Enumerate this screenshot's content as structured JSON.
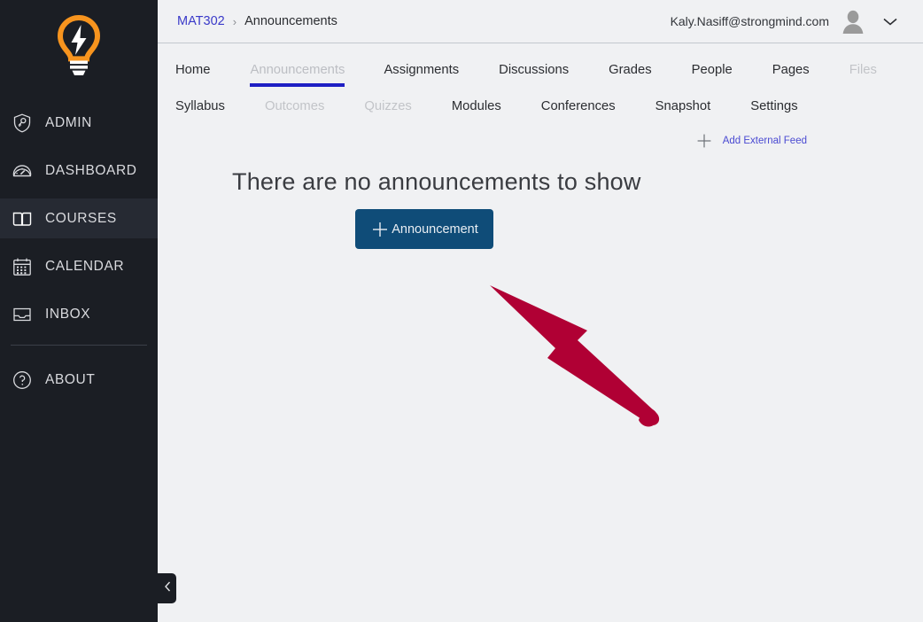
{
  "theme": {
    "sidebar_bg": "#1b1e24",
    "sidebar_active_bg": "#262a33",
    "content_bg": "#f0f1f3",
    "accent_blue": "#1f1fc4",
    "link_blue": "#3a3ac9",
    "button_blue": "#0f4c78",
    "logo_orange": "#F7941E",
    "annotation_red": "#b00034"
  },
  "sidebar": {
    "logo_name": "lightbulb-logo",
    "items": [
      {
        "label": "ADMIN",
        "icon": "shield-key-icon",
        "active": false
      },
      {
        "label": "DASHBOARD",
        "icon": "speedometer-icon",
        "active": false
      },
      {
        "label": "COURSES",
        "icon": "open-book-icon",
        "active": true
      },
      {
        "label": "CALENDAR",
        "icon": "calendar-icon",
        "active": false
      },
      {
        "label": "INBOX",
        "icon": "inbox-tray-icon",
        "active": false
      }
    ],
    "footer_items": [
      {
        "label": "ABOUT",
        "icon": "question-circle-icon",
        "active": false
      }
    ],
    "collapse_icon": "chevron-left-icon"
  },
  "topbar": {
    "breadcrumb": {
      "course": "MAT302",
      "separator": "›",
      "current": "Announcements"
    },
    "user_email": "Kaly.Nasiff@strongmind.com",
    "avatar_icon": "user-avatar-icon",
    "chevron_icon": "chevron-down-icon"
  },
  "course_tabs": {
    "row1": [
      {
        "label": "Home",
        "state": "normal"
      },
      {
        "label": "Announcements",
        "state": "active"
      },
      {
        "label": "Assignments",
        "state": "normal"
      },
      {
        "label": "Discussions",
        "state": "normal"
      },
      {
        "label": "Grades",
        "state": "normal"
      },
      {
        "label": "People",
        "state": "normal"
      },
      {
        "label": "Pages",
        "state": "normal"
      },
      {
        "label": "Files",
        "state": "muted"
      }
    ],
    "row2": [
      {
        "label": "Syllabus",
        "state": "normal"
      },
      {
        "label": "Outcomes",
        "state": "muted"
      },
      {
        "label": "Quizzes",
        "state": "muted"
      },
      {
        "label": "Modules",
        "state": "normal"
      },
      {
        "label": "Conferences",
        "state": "normal"
      },
      {
        "label": "Snapshot",
        "state": "normal"
      },
      {
        "label": "Settings",
        "state": "normal"
      }
    ]
  },
  "content": {
    "external_feed_label": "Add External Feed",
    "external_feed_icon": "plus-icon",
    "empty_title": "There are no announcements to show",
    "announcement_button_label": "Announcement",
    "announcement_button_icon": "plus-icon"
  },
  "annotation": {
    "type": "arrow",
    "points_to": "announcement-button",
    "color": "#b00034"
  }
}
